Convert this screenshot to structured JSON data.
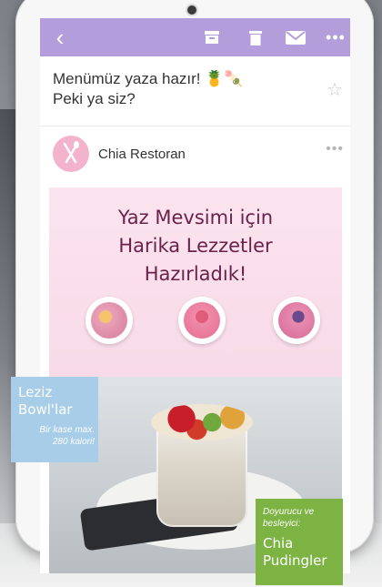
{
  "email": {
    "subject_line1": "Menümüz yaza hazır! 🍍🍡",
    "subject_line2": "Peki ya siz?",
    "sender": "Chia Restoran"
  },
  "toolbar": {
    "icons": [
      "back-icon",
      "archive-icon",
      "trash-icon",
      "mail-icon",
      "more-icon"
    ],
    "color": "#b39ddb"
  },
  "banner": {
    "headline": [
      "Yaz Mevsimi için",
      "Harika Lezzetler",
      "Hazırladık!"
    ],
    "headline_color": "#6b2149",
    "bowls_label": {
      "title": [
        "Leziz",
        "Bowl'lar"
      ],
      "note": [
        "Bir kase max.",
        "280 kalori!"
      ],
      "color": "#a7cde8"
    },
    "pudding_label": {
      "note": [
        "Doyurucu ve",
        "besleyici:"
      ],
      "title": [
        "Chia",
        "Pudingler"
      ],
      "color": "#7cb342"
    }
  }
}
